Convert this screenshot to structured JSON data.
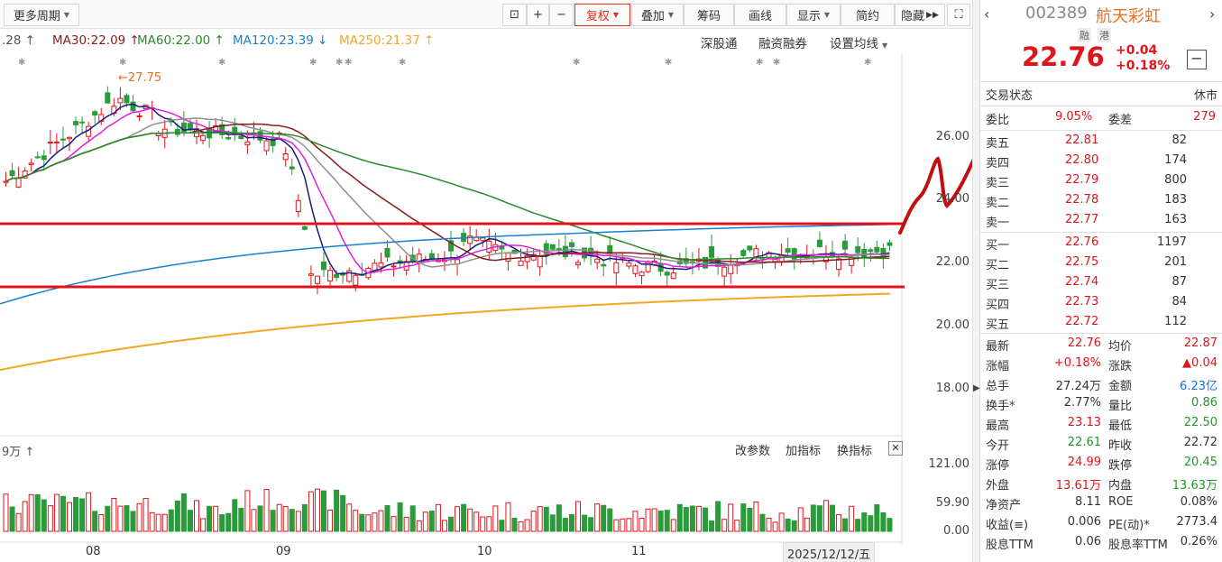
{
  "toolbar": {
    "period": "更多周期",
    "fuquan": "复权",
    "diejia": "叠加",
    "chouma": "筹码",
    "huaxian": "画线",
    "xianshi": "显示",
    "jianjie": "简约",
    "yincang": "隐藏"
  },
  "ma": {
    "ma_partial": ".28",
    "ma30": "MA30:22.09",
    "ma60": "MA60:22.00",
    "ma120": "MA120:23.39",
    "ma250": "MA250:21.37",
    "links": [
      "深股通",
      "融资融券",
      "设置均线"
    ]
  },
  "chart": {
    "y_ticks": [
      "26.00",
      "24.00",
      "22.00",
      "20.00",
      "18.00"
    ],
    "high_label": "27.75",
    "x_months": [
      "08",
      "09",
      "10",
      "11"
    ],
    "date_label": "2025/12/12/五",
    "vol_legend": "9万",
    "vol_ticks": [
      "121.00",
      "59.90",
      "0.00"
    ],
    "vol_links": [
      "改参数",
      "加指标",
      "换指标"
    ],
    "colors": {
      "up": "#e0151c",
      "down": "#2a9a3a",
      "ma5": "#1a1a80",
      "ma10": "#e020e0",
      "ma20": "#909090",
      "ma30": "#8b1a1a",
      "ma60": "#2a8a2a",
      "ma120": "#1a80d0",
      "ma250": "#f5a623",
      "support": "#e0151c"
    }
  },
  "stock": {
    "code": "002389",
    "name": "航天彩虹",
    "tags": [
      "融",
      "港"
    ],
    "price": "22.76",
    "change": "+0.04",
    "change_pct": "+0.18%",
    "status_label": "交易状态",
    "status_value": "休市",
    "weibi_label": "委比",
    "weibi": "9.05%",
    "weicha_label": "委差",
    "weicha": "279"
  },
  "orderbook": {
    "sells": [
      {
        "label": "卖五",
        "price": "22.81",
        "vol": "82"
      },
      {
        "label": "卖四",
        "price": "22.80",
        "vol": "174"
      },
      {
        "label": "卖三",
        "price": "22.79",
        "vol": "800"
      },
      {
        "label": "卖二",
        "price": "22.78",
        "vol": "183"
      },
      {
        "label": "卖一",
        "price": "22.77",
        "vol": "163"
      }
    ],
    "buys": [
      {
        "label": "买一",
        "price": "22.76",
        "vol": "1197"
      },
      {
        "label": "买二",
        "price": "22.75",
        "vol": "201"
      },
      {
        "label": "买三",
        "price": "22.74",
        "vol": "87"
      },
      {
        "label": "买四",
        "price": "22.73",
        "vol": "84"
      },
      {
        "label": "买五",
        "price": "22.72",
        "vol": "112"
      }
    ]
  },
  "stats": [
    {
      "l1": "最新",
      "v1": "22.76",
      "c1": "red",
      "l2": "均价",
      "v2": "22.87",
      "c2": "red"
    },
    {
      "l1": "涨幅",
      "v1": "+0.18%",
      "c1": "red",
      "l2": "涨跌",
      "v2": "▲0.04",
      "c2": "red"
    },
    {
      "l1": "总手",
      "v1": "27.24万",
      "c1": "",
      "l2": "金额",
      "v2": "6.23亿",
      "c2": "blue"
    },
    {
      "l1": "换手*",
      "v1": "2.77%",
      "c1": "",
      "l2": "量比",
      "v2": "0.86",
      "c2": "green"
    },
    {
      "l1": "最高",
      "v1": "23.13",
      "c1": "red",
      "l2": "最低",
      "v2": "22.50",
      "c2": "green"
    },
    {
      "l1": "今开",
      "v1": "22.61",
      "c1": "green",
      "l2": "昨收",
      "v2": "22.72",
      "c2": ""
    },
    {
      "l1": "涨停",
      "v1": "24.99",
      "c1": "red",
      "l2": "跌停",
      "v2": "20.45",
      "c2": "green"
    },
    {
      "l1": "外盘",
      "v1": "13.61万",
      "c1": "red",
      "l2": "内盘",
      "v2": "13.63万",
      "c2": "green"
    },
    {
      "l1": "净资产",
      "v1": "8.11",
      "c1": "",
      "l2": "ROE",
      "v2": "0.08%",
      "c2": ""
    },
    {
      "l1": "收益(≡)",
      "v1": "0.006",
      "c1": "",
      "l2": "PE(动)*",
      "v2": "2773.4",
      "c2": ""
    },
    {
      "l1": "股息TTM",
      "v1": "0.06",
      "c1": "",
      "l2": "股息率TTM",
      "v2": "0.26%",
      "c2": ""
    }
  ]
}
